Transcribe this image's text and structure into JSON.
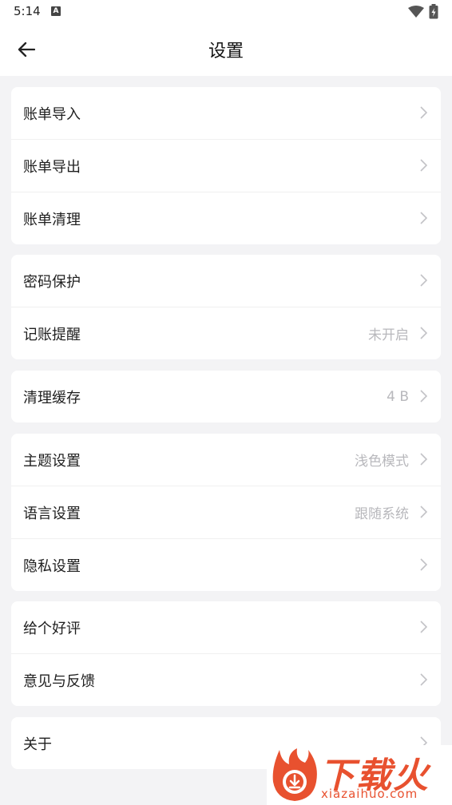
{
  "status_bar": {
    "time": "5:14",
    "notification_badge": "A"
  },
  "header": {
    "title": "设置"
  },
  "groups": [
    {
      "rows": [
        {
          "label": "账单导入",
          "value": ""
        },
        {
          "label": "账单导出",
          "value": ""
        },
        {
          "label": "账单清理",
          "value": ""
        }
      ]
    },
    {
      "rows": [
        {
          "label": "密码保护",
          "value": ""
        },
        {
          "label": "记账提醒",
          "value": "未开启"
        }
      ]
    },
    {
      "rows": [
        {
          "label": "清理缓存",
          "value": "4 B"
        }
      ]
    },
    {
      "rows": [
        {
          "label": "主题设置",
          "value": "浅色模式"
        },
        {
          "label": "语言设置",
          "value": "跟随系统"
        },
        {
          "label": "隐私设置",
          "value": ""
        }
      ]
    },
    {
      "rows": [
        {
          "label": "给个好评",
          "value": ""
        },
        {
          "label": "意见与反馈",
          "value": ""
        }
      ]
    },
    {
      "rows": [
        {
          "label": "关于",
          "value": ""
        }
      ]
    }
  ],
  "watermark": {
    "brand": "下载火",
    "domain": "xiazaihuo.com"
  },
  "colors": {
    "accent_watermark": "#e8512f",
    "value_text": "#b8b8bc",
    "background": "#f3f3f5"
  }
}
